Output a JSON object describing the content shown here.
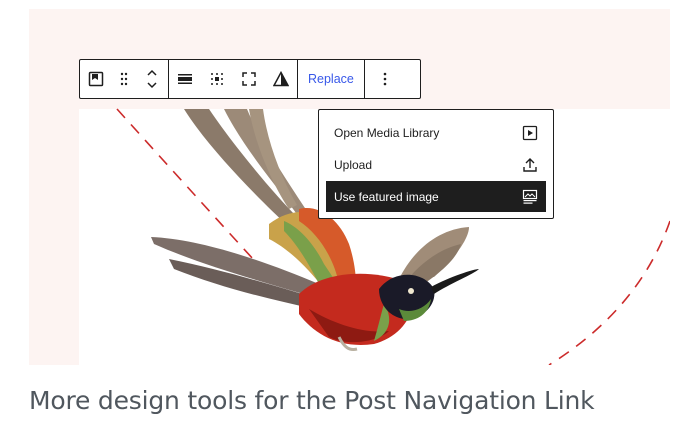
{
  "toolbar": {
    "replace_label": "Replace",
    "icons": [
      "featured-image-icon",
      "drag-handle-icon",
      "move-up-down-icon",
      "align-icon",
      "focal-point-icon",
      "fullscreen-icon",
      "duotone-icon",
      "more-options-icon"
    ]
  },
  "replace_menu": {
    "items": [
      {
        "label": "Open Media Library",
        "icon": "media-library-icon",
        "active": false
      },
      {
        "label": "Upload",
        "icon": "upload-icon",
        "active": false
      },
      {
        "label": "Use featured image",
        "icon": "featured-image-icon",
        "active": true
      }
    ]
  },
  "caption": {
    "text": "More design tools for the Post Navigation Link"
  },
  "colors": {
    "canvas_bg": "#fdf4f2",
    "accent": "#3858e9",
    "dashed_line": "#cc2b2b",
    "toolbar_border": "#1e1e1e",
    "caption": "#50575e"
  }
}
